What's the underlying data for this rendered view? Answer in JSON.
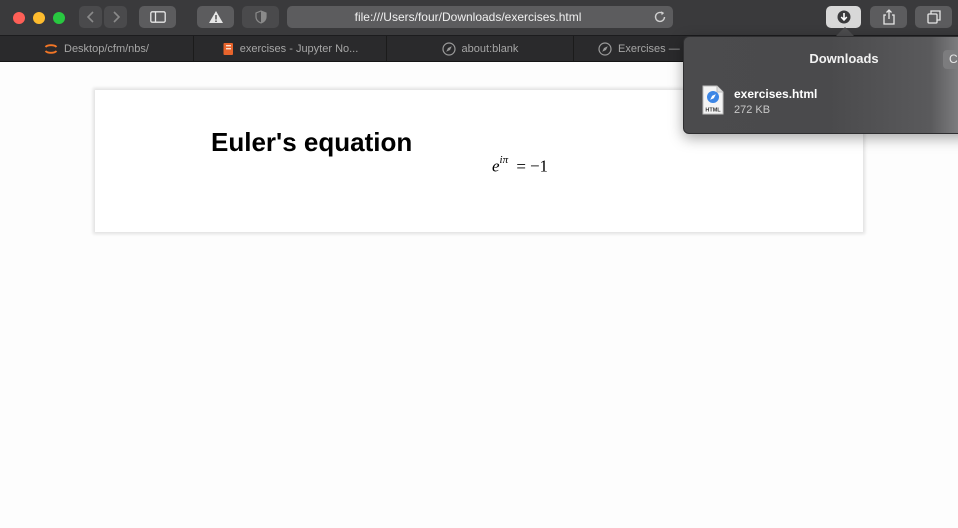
{
  "browser": {
    "url": "file:///Users/four/Downloads/exercises.html",
    "tabs": [
      {
        "label": "Desktop/cfm/nbs/",
        "icon": "jupyter-icon"
      },
      {
        "label": "exercises - Jupyter No...",
        "icon": "notebook-icon"
      },
      {
        "label": "about:blank",
        "icon": "compass-icon"
      },
      {
        "label": "Exercises —",
        "icon": "compass-icon"
      }
    ]
  },
  "page": {
    "heading": "Euler's equation",
    "equation": {
      "base": "e",
      "exponent": "iπ",
      "operator": "=",
      "rhs": "−1"
    }
  },
  "downloads": {
    "title": "Downloads",
    "clear_label": "Clear",
    "items": [
      {
        "name": "exercises.html",
        "size": "272 KB",
        "icon_label": "HTML"
      }
    ]
  },
  "colors": {
    "toolbar": "#3a3a3c",
    "tabbar": "#2a2a2c",
    "jupyter_orange": "#f37626",
    "notebook_orange": "#e8642c",
    "file_icon_blue": "#3d86e5"
  }
}
